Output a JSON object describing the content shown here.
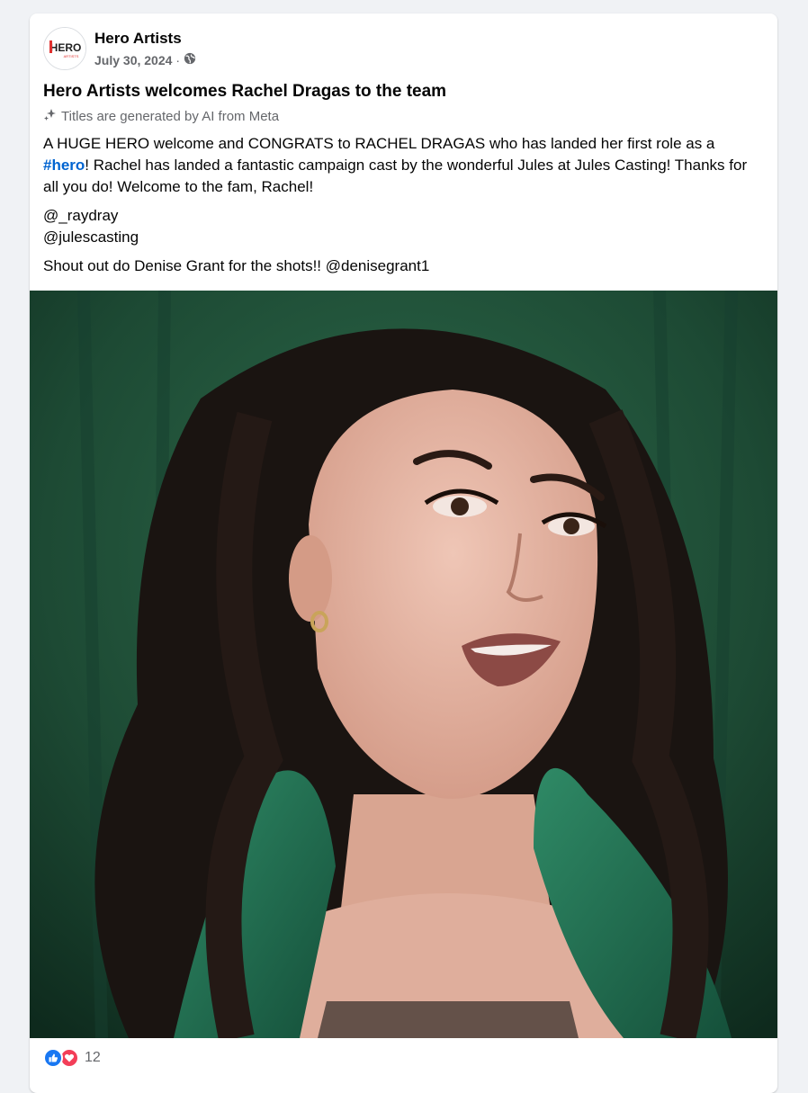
{
  "post": {
    "author": "Hero Artists",
    "date": "July 30, 2024",
    "separator": "·",
    "title": "Hero Artists welcomes Rachel Dragas to the team",
    "ai_note": "Titles are generated by AI from Meta",
    "body": {
      "line1_before": "A HUGE HERO welcome and CONGRATS to RACHEL DRAGAS who has landed her first role as a ",
      "hashtag": "#hero",
      "line1_after": "!  Rachel has landed a fantastic campaign cast by the wonderful Jules at Jules Casting!  Thanks for all you do!  Welcome to the fam, Rachel!",
      "mention1": "@_raydray",
      "mention2": "@julescasting",
      "shoutout": "Shout out do Denise Grant for the shots!! @denisegrant1"
    },
    "logo_text": "HERO",
    "logo_subtext": "ARTISTS",
    "reaction_count": "12",
    "reactions": [
      "like",
      "love"
    ]
  },
  "colors": {
    "link": "#0064d1",
    "meta": "#65676b",
    "like": "#1877f2",
    "love": "#f33e58",
    "photo_bg": "#1f4f37"
  }
}
